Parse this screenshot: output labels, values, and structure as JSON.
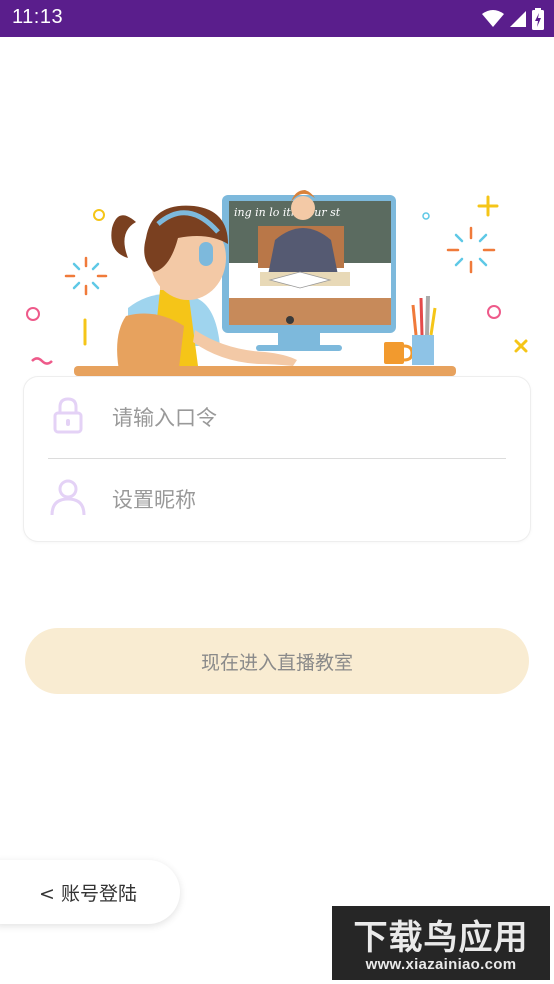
{
  "status_bar": {
    "time": "11:13"
  },
  "login": {
    "password_placeholder": "请输入口令",
    "nickname_placeholder": "设置昵称"
  },
  "enter_button": {
    "label": "现在进入直播教室"
  },
  "account_login": {
    "label": "< 账号登陆"
  },
  "watermark": {
    "title": "下载鸟应用",
    "url": "www.xiazainiao.com"
  },
  "illustration": {
    "board_text": "ing in lo ith your st"
  },
  "colors": {
    "status_bar": "#5a1e8c",
    "button_bg": "#f9ecd2",
    "icon_purple": "#d9c2f0"
  }
}
